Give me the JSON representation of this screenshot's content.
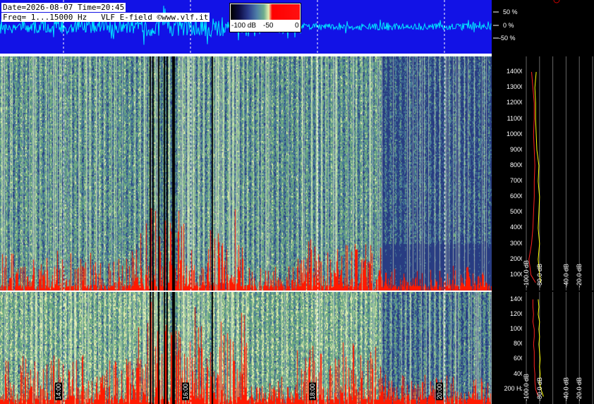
{
  "header": {
    "line1": "Date=2026-08-07 Time=20:45",
    "line2": "Freq= 1...15000 Hz   VLF E-field ©www.vlf.it"
  },
  "colorbar": {
    "labels": [
      "-100 dB",
      "-50",
      "0"
    ]
  },
  "waveform_scale": [
    "50 %",
    "0 %",
    "-50 %"
  ],
  "chart_data": [
    {
      "type": "heatmap",
      "title": "",
      "xlabel": "",
      "ylabel": "",
      "x_tick_labels": [
        "14:00",
        "16:00",
        "18:00",
        "20:00"
      ],
      "upper_panel": {
        "y_ticks_hz": [
          1000,
          2000,
          3000,
          4000,
          5000,
          6000,
          7000,
          8000,
          9000,
          10000,
          11000,
          12000,
          13000,
          14000
        ],
        "ylim": [
          0,
          15000
        ]
      },
      "lower_panel": {
        "y_ticks_hz": [
          200,
          400,
          600,
          800,
          1000,
          1200,
          1400
        ],
        "y_tick_labels": [
          "200 Hz",
          "400",
          "600",
          "800",
          "1000",
          "1200",
          "1400"
        ],
        "ylim": [
          0,
          1500
        ]
      },
      "colorscale_db": [
        -100,
        0
      ]
    },
    {
      "type": "line",
      "panel": "average-spectrum-upper",
      "x_tick_labels": [
        "-100.0 dB",
        "-80.0 dB",
        "-40.0 dB",
        "-20.0 dB"
      ],
      "xlim": [
        -100,
        0
      ],
      "series": [
        {
          "color": "#ffff00",
          "y_hz": [
            500,
            1000,
            2000,
            3000,
            4000,
            5000,
            6000,
            7000,
            8000,
            9000,
            10000,
            11000,
            12000,
            13000,
            14000
          ],
          "x_db": [
            -78,
            -80,
            -82,
            -80,
            -82,
            -81,
            -80,
            -82,
            -81,
            -84,
            -85,
            -86,
            -86,
            -87,
            -85
          ]
        },
        {
          "color": "#ff2020",
          "y_hz": [
            500,
            1000,
            2000,
            3000,
            4000,
            5000,
            6000,
            7000,
            8000,
            9000,
            10000,
            11000,
            12000,
            13000,
            14000
          ],
          "x_db": [
            -86,
            -93,
            -96,
            -92,
            -90,
            -89,
            -88,
            -88,
            -87,
            -88,
            -89,
            -88,
            -88,
            -90,
            -92
          ]
        }
      ]
    },
    {
      "type": "line",
      "panel": "average-spectrum-lower",
      "x_tick_labels": [
        "-100.0 dB",
        "-80.0 dB",
        "-40.0 dB",
        "-20.0 dB"
      ],
      "xlim": [
        -100,
        0
      ],
      "series": [
        {
          "color": "#ffff00",
          "y_hz": [
            100,
            200,
            300,
            400,
            500,
            600,
            700,
            800,
            900,
            1000,
            1100,
            1200,
            1300,
            1400
          ],
          "x_db": [
            -74,
            -78,
            -80,
            -79,
            -80,
            -79,
            -80,
            -81,
            -80,
            -81,
            -80,
            -82,
            -81,
            -82
          ]
        },
        {
          "color": "#ff2020",
          "y_hz": [
            100,
            200,
            300,
            400,
            500,
            600,
            700,
            800,
            900,
            1000,
            1100,
            1200,
            1300,
            1400
          ],
          "x_db": [
            -82,
            -86,
            -87,
            -87,
            -88,
            -88,
            -88,
            -89,
            -88,
            -88,
            -90,
            -89,
            -90,
            -90
          ]
        }
      ]
    }
  ],
  "colors": {
    "waveform_bg": "#1212e6",
    "waveform": "#00e5ff",
    "intense": "#ff1a00",
    "spectrum_low": "#2a3a8a",
    "spectrum_mid": "#7ab08e"
  }
}
